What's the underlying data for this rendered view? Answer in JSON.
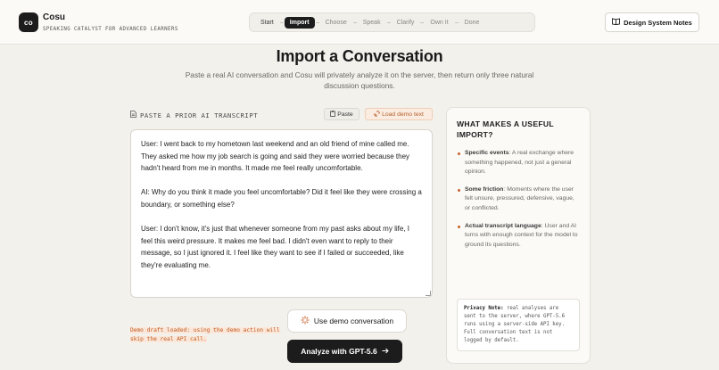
{
  "app": {
    "logo_text": "co",
    "name": "Cosu",
    "tagline": "SPEAKING CATALYST FOR ADVANCED LEARNERS"
  },
  "stepper": {
    "steps": [
      "Start",
      "Import",
      "Choose",
      "Speak",
      "Clarify",
      "Own It",
      "Done"
    ],
    "active": "Import"
  },
  "header": {
    "design_notes_label": "Design System Notes",
    "design_notes_icon": "book-open-icon"
  },
  "main": {
    "title": "Import a Conversation",
    "subtitle": "Paste a real AI conversation and Cosu will privately analyze it on the server, then return only three natural discussion questions.",
    "section_label": "PASTE A PRIOR AI TRANSCRIPT",
    "section_icon": "document-icon",
    "paste_label": "Paste",
    "paste_icon": "clipboard-icon",
    "load_demo_label": "Load demo text",
    "load_demo_icon": "link-icon",
    "transcript": [
      "User: I went back to my hometown last weekend and an old friend of mine called me. They asked me how my job search is going and said they were worried because they hadn't heard from me in months. It made me feel really uncomfortable.",
      "AI: Why do you think it made you feel uncomfortable? Did it feel like they were crossing a boundary, or something else?",
      "User: I don't know, it's just that whenever someone from my past asks about my life, I feel this weird pressure. It makes me feel bad. I didn't even want to reply to their message, so I just ignored it. I feel like they want to see if I failed or succeeded, like they're evaluating me."
    ],
    "status_note": "Demo draft loaded: using the demo action will skip the real API call.",
    "use_demo_label": "Use demo conversation",
    "use_demo_icon": "sparkle-icon",
    "analyze_label": "Analyze with GPT-5.6",
    "analyze_icon": "arrow-right-icon"
  },
  "sidebar": {
    "title": "WHAT MAKES A USEFUL IMPORT?",
    "tips": [
      {
        "heading": "Specific events",
        "text": ": A real exchange where something happened, not just a general opinion."
      },
      {
        "heading": "Some friction",
        "text": ": Moments where the user felt unsure, pressured, defensive, vague, or conflicted."
      },
      {
        "heading": "Actual transcript language",
        "text": ": User and AI turns with enough context for the model to ground its questions."
      }
    ],
    "privacy_heading": "Privacy Note:",
    "privacy_text": " real analyses are sent to the server, where GPT-5.6 runs using a server-side API key. Full conversation text is not logged by default."
  },
  "colors": {
    "accent": "#c8612c",
    "dark": "#1c1c1c",
    "background": "#f3f1ec"
  }
}
